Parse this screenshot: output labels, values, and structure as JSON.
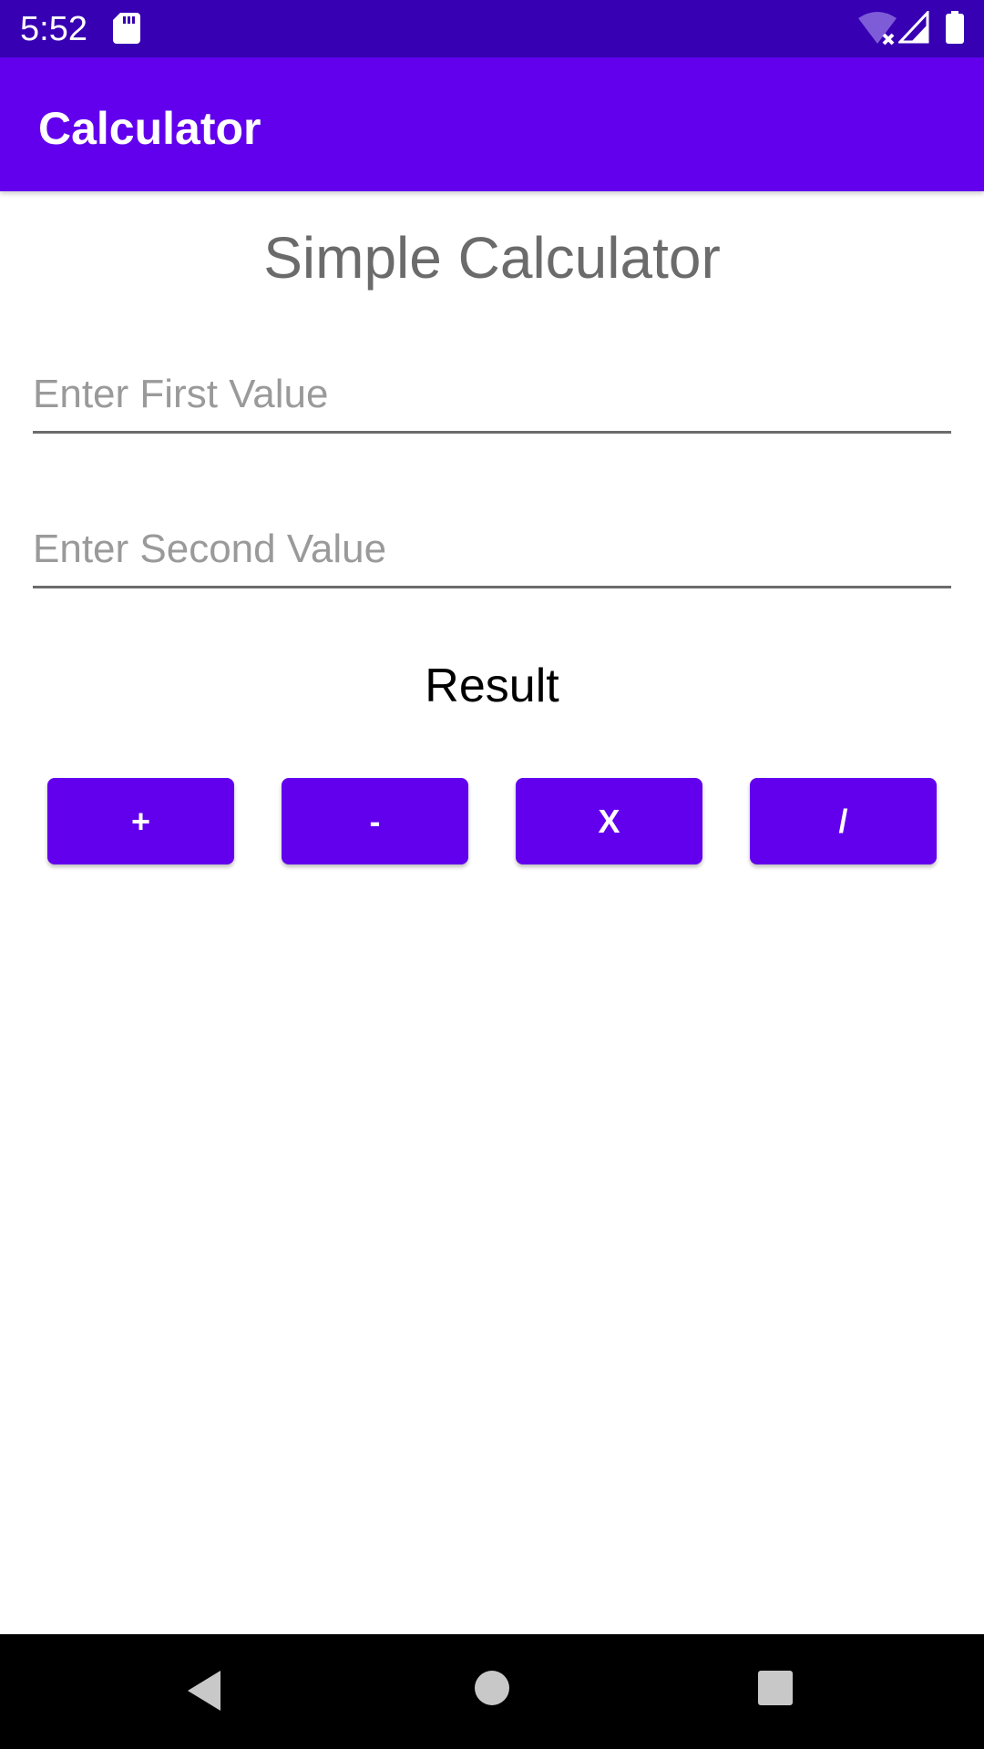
{
  "status_bar": {
    "time": "5:52",
    "icons": [
      "sd-card-icon",
      "wifi-off-icon",
      "signal-icon",
      "battery-icon"
    ],
    "background": "#3700b3"
  },
  "app_bar": {
    "title": "Calculator",
    "background": "#6200ee"
  },
  "main": {
    "heading": "Simple Calculator",
    "first_input": {
      "placeholder": "Enter First Value",
      "value": ""
    },
    "second_input": {
      "placeholder": "Enter Second Value",
      "value": ""
    },
    "result_label": "Result",
    "buttons": {
      "add": "+",
      "subtract": "-",
      "multiply": "X",
      "divide": "/"
    },
    "button_color": "#6200ee"
  },
  "nav_bar": {
    "icons": [
      "back-icon",
      "home-icon",
      "recents-icon"
    ]
  }
}
